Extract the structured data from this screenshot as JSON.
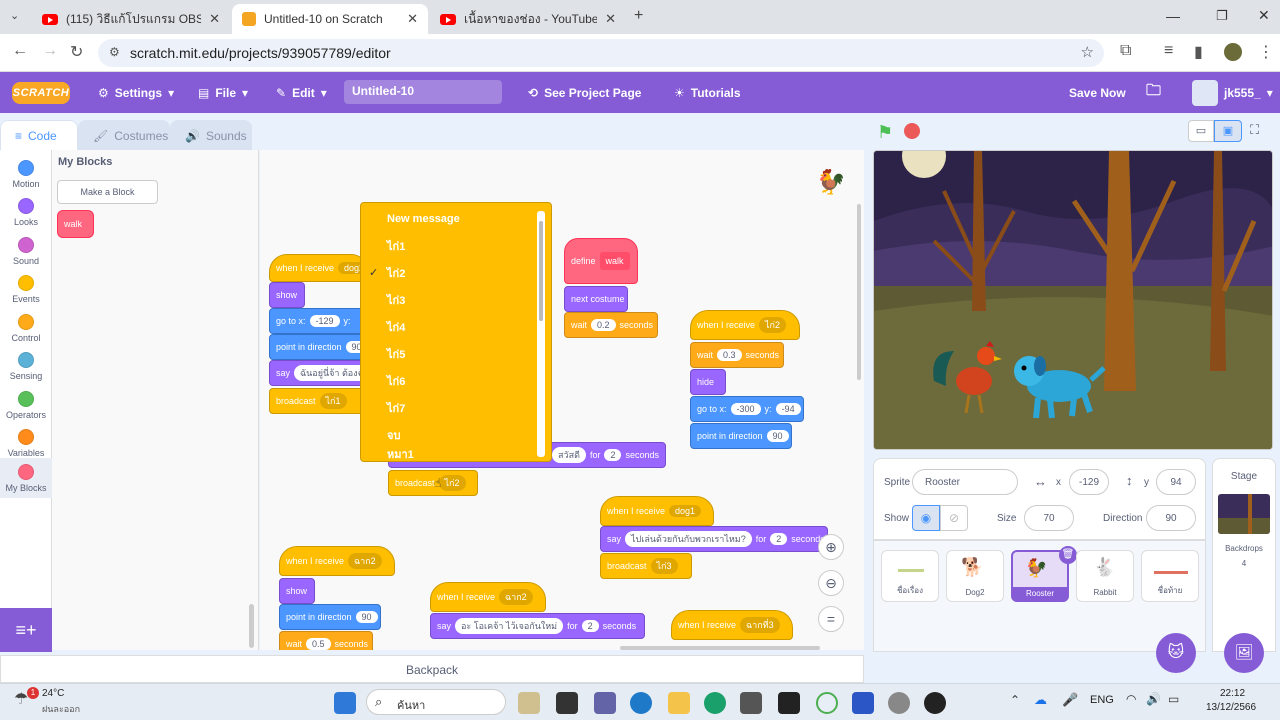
{
  "browser": {
    "tabs": [
      {
        "title": "(115) วิธีแก้โปรแกรม OBS ไม่สามารถ",
        "type": "youtube"
      },
      {
        "title": "Untitled-10 on Scratch",
        "type": "scratch"
      },
      {
        "title": "เนื้อหาของช่อง - YouTube Studio",
        "type": "youtube"
      }
    ],
    "url": "scratch.mit.edu/projects/939057789/editor"
  },
  "menu": {
    "logo": "SCRATCH",
    "settings": "Settings",
    "file": "File",
    "edit": "Edit",
    "project_title": "Untitled-10",
    "see_project": "See Project Page",
    "tutorials": "Tutorials",
    "save_now": "Save Now",
    "username": "jk555_"
  },
  "editor_tabs": {
    "code": "Code",
    "costumes": "Costumes",
    "sounds": "Sounds"
  },
  "categories": [
    {
      "label": "Motion",
      "color": "#4c97ff"
    },
    {
      "label": "Looks",
      "color": "#9966ff"
    },
    {
      "label": "Sound",
      "color": "#cf63cf"
    },
    {
      "label": "Events",
      "color": "#ffbf00"
    },
    {
      "label": "Control",
      "color": "#ffab19"
    },
    {
      "label": "Sensing",
      "color": "#5cb1d6"
    },
    {
      "label": "Operators",
      "color": "#59c059"
    },
    {
      "label": "Variables",
      "color": "#ff8c1a"
    },
    {
      "label": "My Blocks",
      "color": "#ff6680"
    }
  ],
  "flyout": {
    "heading": "My Blocks",
    "make_block": "Make a Block",
    "block": "walk"
  },
  "blocks": {
    "when_receive": "when I receive",
    "show": "show",
    "hide": "hide",
    "go_to_x": "go to x:",
    "y": "y:",
    "point_dir": "point in direction",
    "say": "say",
    "for": "for",
    "seconds": "seconds",
    "wait": "wait",
    "broadcast": "broadcast",
    "define": "define",
    "walk": "walk",
    "next_costume": "next costume",
    "dog2": "dog2",
    "gai1": "ไก่1",
    "gai2": "ไก่2",
    "gai3": "ไก่3",
    "dog1": "dog1",
    "v129": "-129",
    "v90": "90",
    "v02": "0.2",
    "v03": "0.3",
    "v05": "0.5",
    "v300": "-300",
    "v94": "-94",
    "v2": "2",
    "say1": "ฉันอยู่นี่จ้า ต้องฉั",
    "say2": "ไปเล่นด้วยกันกับพวกเราไหม?",
    "say3": "อะ โอเคจ้า ไว้เจอกันใหม่",
    "say4": "สวัสดี",
    "lak2": "ฉาก2",
    "lak3": "ฉากที่3"
  },
  "dropdown": {
    "items": [
      "New message",
      "ไก่1",
      "ไก่2",
      "ไก่3",
      "ไก่4",
      "ไก่5",
      "ไก่6",
      "ไก่7",
      "จบ",
      "หมา1"
    ],
    "selected_index": 2
  },
  "sprite_info": {
    "sprite_label": "Sprite",
    "sprite_name": "Rooster",
    "x_label": "x",
    "x": "-129",
    "y_label": "y",
    "y": "94",
    "show_label": "Show",
    "size_label": "Size",
    "size": "70",
    "direction_label": "Direction",
    "direction": "90"
  },
  "sprites": [
    {
      "name": "ชื่อเรื่อง",
      "selected": false
    },
    {
      "name": "Dog2",
      "selected": false
    },
    {
      "name": "Rooster",
      "selected": true
    },
    {
      "name": "Rabbit",
      "selected": false
    },
    {
      "name": "ชื่อท้าย",
      "selected": false
    }
  ],
  "stage_panel": {
    "title": "Stage",
    "backdrops_label": "Backdrops",
    "backdrops_count": "4"
  },
  "backpack": "Backpack",
  "taskbar": {
    "weather_temp": "24°C",
    "weather_desc": "ฝนละออก",
    "search": "ค้นหา",
    "lang": "ENG",
    "time": "22:12",
    "date": "13/12/2566",
    "badge": "1"
  }
}
